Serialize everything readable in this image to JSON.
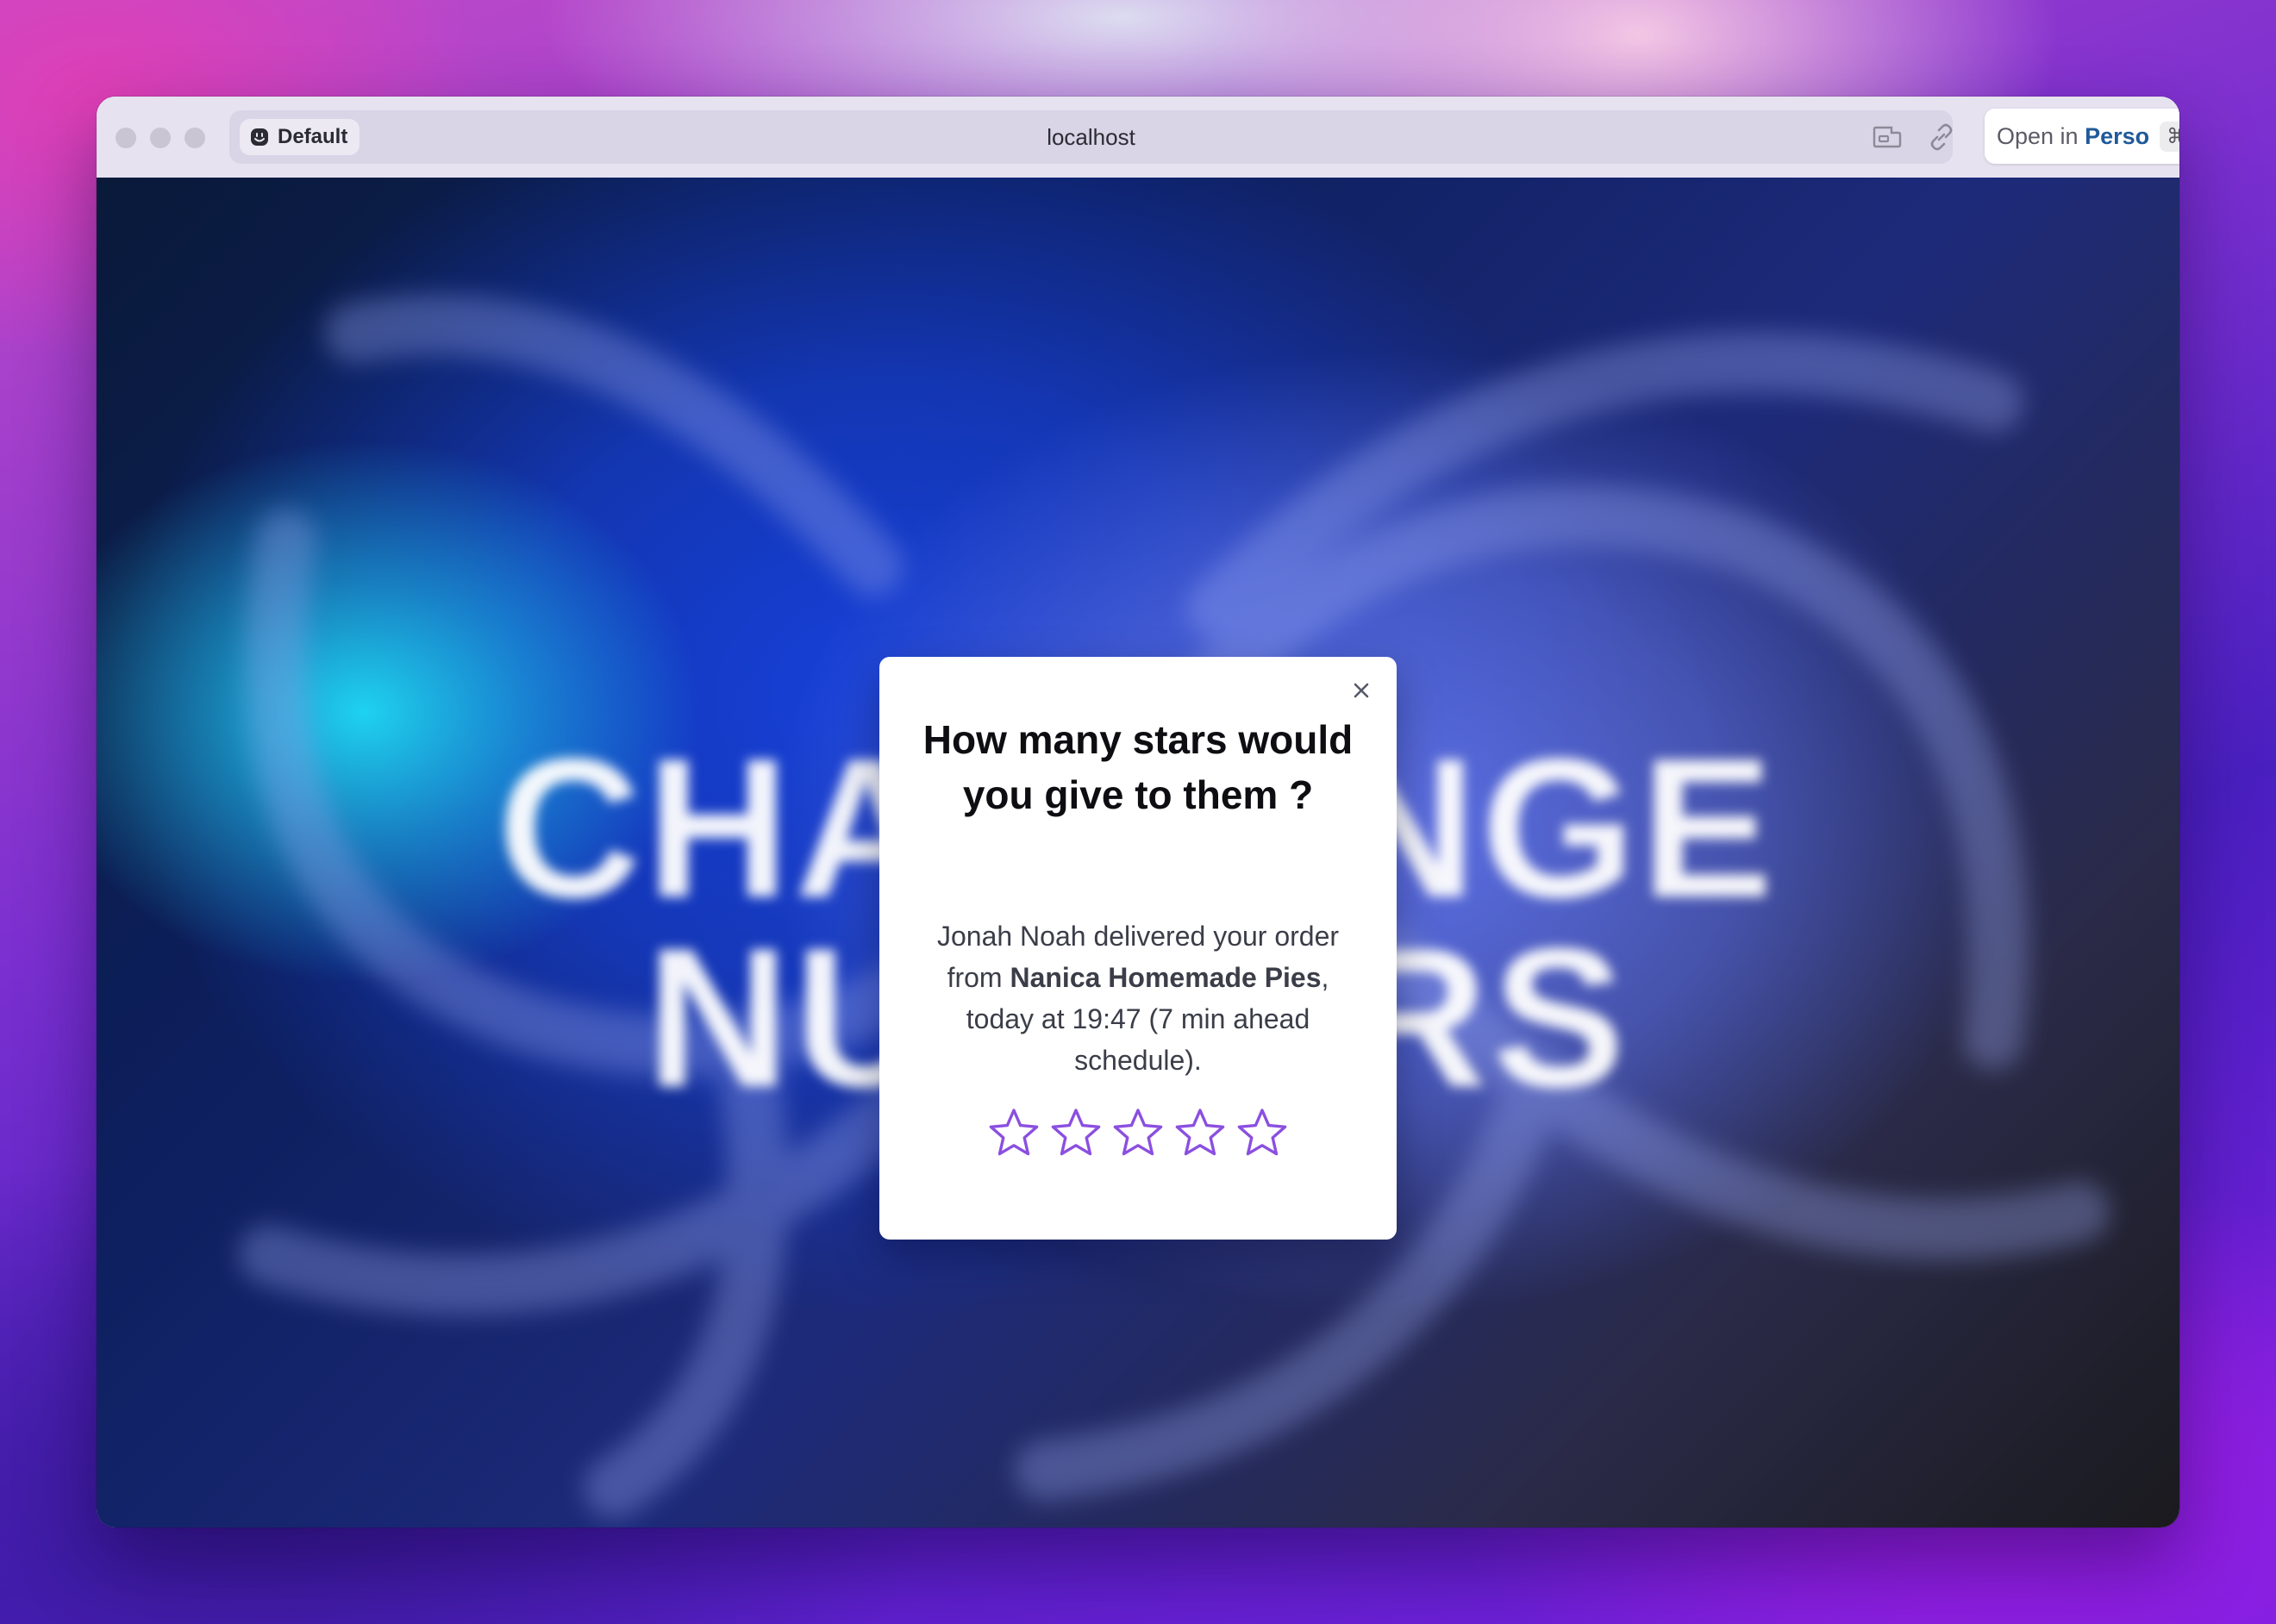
{
  "browser": {
    "profile_label": "Default",
    "address": "localhost",
    "open_in": {
      "prefix": "Open in",
      "app": "Perso",
      "shortcut": "⌘O"
    }
  },
  "page": {
    "background_text_line1": "CHALLENGE",
    "background_text_line2": "NUXTERS"
  },
  "modal": {
    "title": "How many stars would you give to them ?",
    "body_part1": "Jonah Noah delivered your order from ",
    "body_bold": "Nanica Homemade Pies",
    "body_part2": ", today at 19:47 (7 min ahead schedule).",
    "rating": {
      "selected": 0,
      "max": 5
    },
    "star_color": "#8b4fe0"
  },
  "icons": {
    "profile": "smiley-icon",
    "extension": "extension-icon",
    "link": "link-icon",
    "chevron": "chevron-down-icon",
    "close": "close-icon",
    "devtools": "nuxt-logo-icon"
  }
}
